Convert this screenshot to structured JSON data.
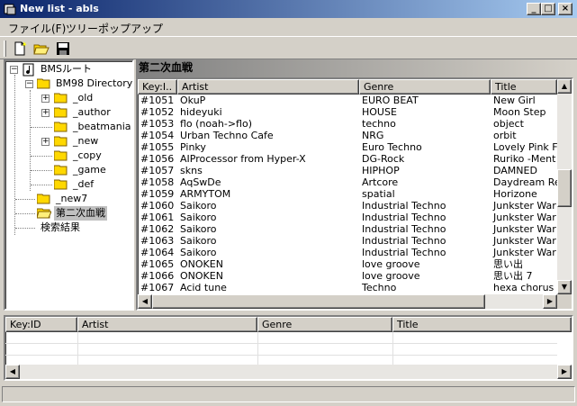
{
  "window": {
    "title": "New list - abls",
    "minimize": "_",
    "maximize": "□",
    "close": "×"
  },
  "menu": {
    "file": "ファイル(F)",
    "tree_popup": "ツリーポップアップ"
  },
  "toolbar": {
    "new_icon": "new-document-icon",
    "open_icon": "open-folder-icon",
    "save_icon": "save-disk-icon"
  },
  "tree": {
    "root": "BMSルート",
    "bm98": "BM98 Directory",
    "items": [
      "_old",
      "_author",
      "_beatmania",
      "_new",
      "_copy",
      "_game",
      "_def"
    ],
    "new7": "_new7",
    "selected": "第二次血戦",
    "search": "検索結果"
  },
  "list": {
    "title": "第二次血戦",
    "columns": [
      "Key:I..",
      "Artist",
      "Genre",
      "Title"
    ],
    "rows": [
      [
        "#1051",
        "OkuP",
        "EURO BEAT",
        "New Girl"
      ],
      [
        "#1052",
        "hideyuki",
        "HOUSE",
        "Moon Step"
      ],
      [
        "#1053",
        "flo (noah->flo)",
        "techno",
        "object"
      ],
      [
        "#1054",
        "Urban Techno Cafe",
        "NRG",
        "orbit"
      ],
      [
        "#1055",
        "Pinky",
        "Euro Techno",
        "Lovely Pink F"
      ],
      [
        "#1056",
        "AIProcessor from Hyper-X",
        "DG-Rock",
        "Ruriko -Ment"
      ],
      [
        "#1057",
        "skns",
        "HIPHOP",
        "DAMNED"
      ],
      [
        "#1058",
        "AqSwDe",
        "Artcore",
        "Daydream Re"
      ],
      [
        "#1059",
        "ARMYTOM",
        "spatial",
        "Horizone"
      ],
      [
        "#1060",
        "Saikoro",
        "Industrial Techno",
        "Junkster War"
      ],
      [
        "#1061",
        "Saikoro",
        "Industrial Techno",
        "Junkster War"
      ],
      [
        "#1062",
        "Saikoro",
        "Industrial Techno",
        "Junkster War"
      ],
      [
        "#1063",
        "Saikoro",
        "Industrial Techno",
        "Junkster War"
      ],
      [
        "#1064",
        "Saikoro",
        "Industrial Techno",
        "Junkster War"
      ],
      [
        "#1065",
        "ONOKEN",
        "love groove",
        "思い出"
      ],
      [
        "#1066",
        "ONOKEN",
        "love groove",
        "思い出 7"
      ],
      [
        "#1067",
        "Acid tune",
        "Techno",
        "hexa chorus"
      ]
    ]
  },
  "bottom": {
    "columns": [
      "Key:ID",
      "Artist",
      "Genre",
      "Title"
    ]
  }
}
